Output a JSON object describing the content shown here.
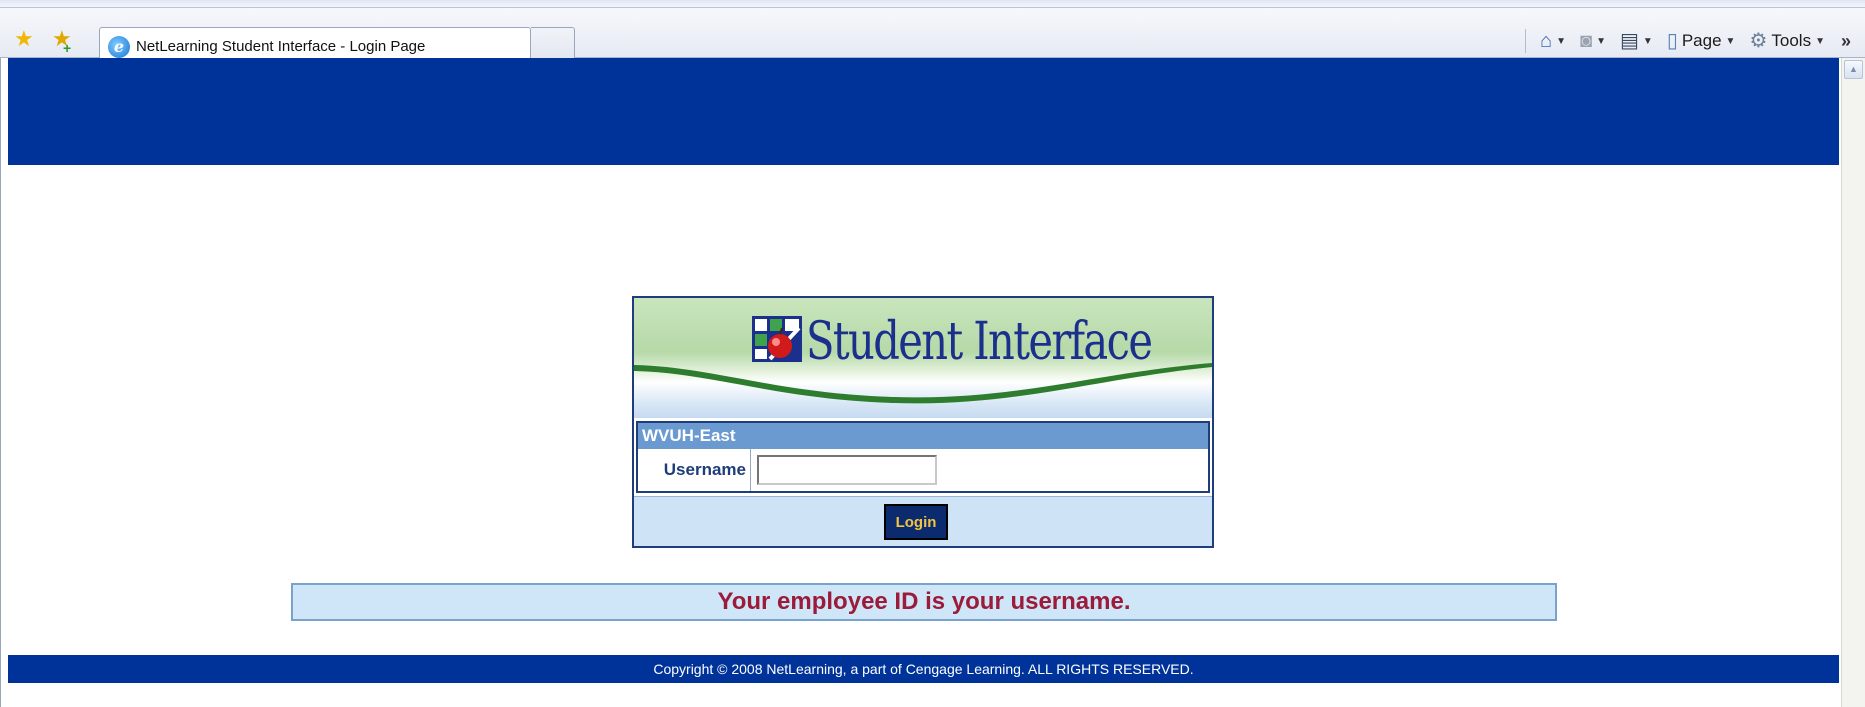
{
  "browser": {
    "tab_title": "NetLearning Student Interface - Login Page",
    "commands": {
      "page_label": "Page",
      "tools_label": "Tools"
    }
  },
  "login": {
    "banner_title": "Student Interface",
    "organization": "WVUH-East",
    "username_label": "Username",
    "username_value": "",
    "login_button": "Login"
  },
  "notice": "Your employee ID is your username.",
  "footer": "Copyright © 2008 NetLearning, a part of Cengage Learning. ALL RIGHTS RESERVED.",
  "colors": {
    "header_band": "#003399",
    "footer_band": "#003399",
    "notice_text": "#9b1b3a",
    "login_button_bg": "#0c2a6e",
    "login_button_text": "#f3c442"
  },
  "icons": {
    "favorites": "star-icon",
    "add_favorites": "add-favorites-icon",
    "browser": "internet-explorer-icon",
    "home": "home-icon",
    "feeds": "rss-feed-icon",
    "print": "printer-icon",
    "page": "page-icon",
    "tools": "gear-icon",
    "more": "chevron-double-right-icon",
    "scroll_up": "arrow-up-icon"
  }
}
